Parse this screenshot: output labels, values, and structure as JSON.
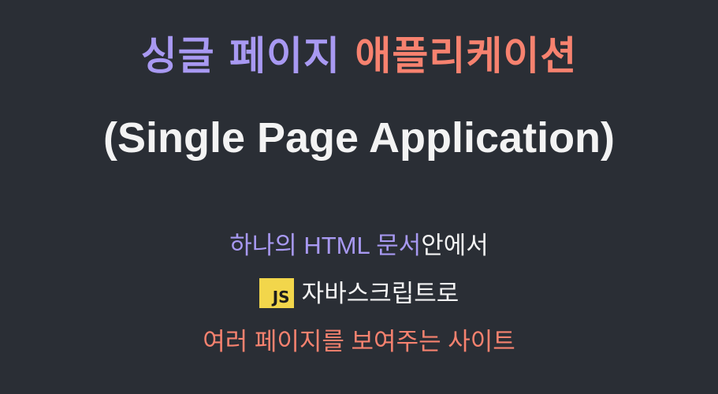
{
  "colors": {
    "background": "#2a2e35",
    "purple": "#a899f2",
    "salmon": "#f7826f",
    "white": "#f3f3f3",
    "js_badge_bg": "#f2d64b"
  },
  "title": {
    "korean_part1": "싱글 페이지",
    "korean_part2": "애플리케이션",
    "english": "(Single Page Application)"
  },
  "lines": {
    "line1_purple": "하나의 HTML 문서",
    "line1_white": "안에서",
    "line2_badge": "JS",
    "line2_text": "자바스크립트로",
    "line3_salmon": "여러 페이지를 보여주는 사이트"
  },
  "icons": {
    "js_badge": "javascript-logo-icon"
  }
}
